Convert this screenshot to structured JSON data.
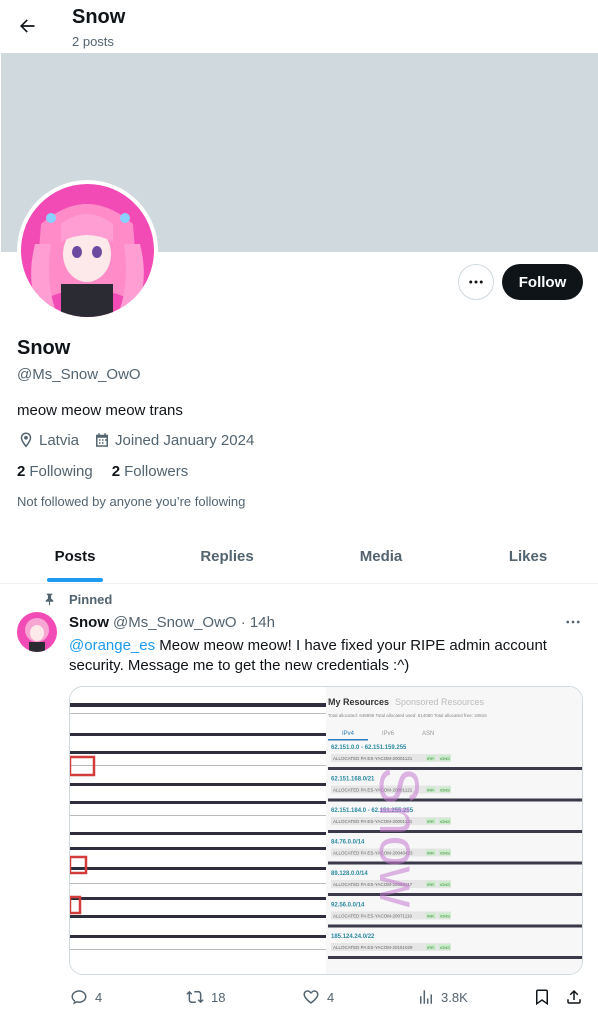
{
  "header": {
    "title": "Snow",
    "subtitle": "2 posts"
  },
  "profile": {
    "display_name": "Snow",
    "handle": "@Ms_Snow_OwO",
    "bio": "meow meow meow trans",
    "location": "Latvia",
    "joined": "Joined January 2024",
    "following_count": "2",
    "following_label": "Following",
    "followers_count": "2",
    "followers_label": "Followers",
    "followed_note": "Not followed by anyone you’re following",
    "follow_label": "Follow"
  },
  "tabs": [
    {
      "label": "Posts",
      "active": true
    },
    {
      "label": "Replies",
      "active": false
    },
    {
      "label": "Media",
      "active": false
    },
    {
      "label": "Likes",
      "active": false
    }
  ],
  "post": {
    "pinned_label": "Pinned",
    "author_name": "Snow",
    "author_handle_time": "@Ms_Snow_OwO · 14h",
    "mention": "@orange_es",
    "text": " Meow meow meow! I have fixed your RIPE admin account security. Message me to get the new credentials :^)",
    "media": {
      "tabs_title": "My Resources",
      "tabs_title2": "Sponsored Resources",
      "summary": "Total allocated: 648896   Total allocated used: 614080   Total allocated free: 34816",
      "subtabs": [
        "IPv4",
        "IPv6",
        "ASN"
      ],
      "watermark": "Snow",
      "rows": [
        {
          "range": "62.151.0.0 - 62.151.159.255",
          "status": "ALLOCATED PA",
          "org": "ES-YACOM-20001121"
        },
        {
          "range": "62.151.168.0/21",
          "status": "ALLOCATED PA",
          "org": "ES-YACOM-20001121"
        },
        {
          "range": "62.151.184.0 - 62.151.255.255",
          "status": "ALLOCATED PA",
          "org": "ES-YACOM-20001121"
        },
        {
          "range": "84.76.0.0/14",
          "status": "ALLOCATED PA",
          "org": "ES-YACOM-20040423"
        },
        {
          "range": "89.128.0.0/14",
          "status": "ALLOCATED PA",
          "org": "ES-YACOM-20060117"
        },
        {
          "range": "92.56.0.0/14",
          "status": "ALLOCATED PA",
          "org": "ES-YACOM-20071119"
        },
        {
          "range": "185.124.24.0/22",
          "status": "ALLOCATED PA",
          "org": "ES-YACOM-20151029"
        }
      ],
      "badge1": "IRR",
      "badge2": "rDNS"
    },
    "actions": {
      "replies": "4",
      "reposts": "18",
      "likes": "4",
      "views": "3.8K"
    }
  },
  "colors": {
    "accent": "#1d9bf0",
    "banner": "#cfd9de",
    "muted": "#536471",
    "text": "#0f1419"
  }
}
